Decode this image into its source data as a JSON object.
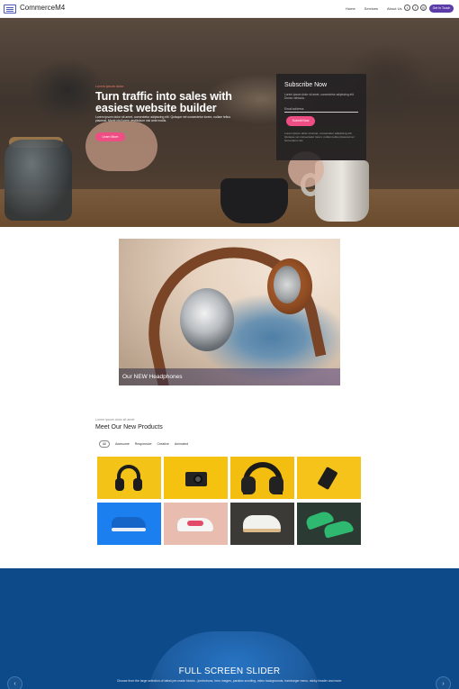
{
  "nav": {
    "brand": "CommerceM4",
    "links": [
      "Home",
      "Services",
      "About Us"
    ],
    "social": [
      "twitter-icon",
      "facebook-icon",
      "instagram-icon"
    ],
    "cta": "Get In Touch"
  },
  "hero": {
    "eyebrow": "Lorem ipsum dolor",
    "title": "Turn traffic into sales with easiest website builder",
    "text": "Lorem ipsum dolor sit amet, consectetur adipiscing elit. Quisque vel consectetur lorem, nullam tellus placerat. Morbi nisl lorem vestibulum nisi ante mollis.",
    "button": "Learn More"
  },
  "subscribe": {
    "title": "Subscribe Now",
    "text": "Lorem ipsum dolor sit amet, consectetur adipiscing elit. Donec vehicula.",
    "placeholder": "Email address",
    "button": "Submit Now",
    "note": "Lorem ipsum dolor sit amet, consectetur adipiscing elit. Quisque vel consectetur lorem, nullam tellus placerat vel fermentum nisi."
  },
  "feature": {
    "label": "Our NEW Headphones"
  },
  "products": {
    "eyebrow": "Lorem ipsum dolor sit amet",
    "title": "Meet Our New Products",
    "filters": [
      "All",
      "Awesome",
      "Responsive",
      "Creative",
      "Animated"
    ],
    "tiles": [
      {
        "name": "headphones-black",
        "bg": "#f3c417"
      },
      {
        "name": "camera",
        "bg": "#f5c20f"
      },
      {
        "name": "headphones-dark",
        "bg": "#f4be10"
      },
      {
        "name": "smartphone",
        "bg": "#f6c31a"
      },
      {
        "name": "sneaker-blue",
        "bg": "#1b7ff0"
      },
      {
        "name": "sneaker-pink",
        "bg": "#e8bdb0"
      },
      {
        "name": "sneaker-white",
        "bg": "#3c3a36"
      },
      {
        "name": "sneakers-green",
        "bg": "#2b3b33"
      }
    ]
  },
  "slider": {
    "title": "FULL SCREEN SLIDER",
    "text": "Choose from the large selection of latest pre-made blocks - jumbotrons, hero images, parallax scrolling, video backgrounds, hamburger menu, sticky header and more.",
    "prev": "‹",
    "next": "›"
  }
}
